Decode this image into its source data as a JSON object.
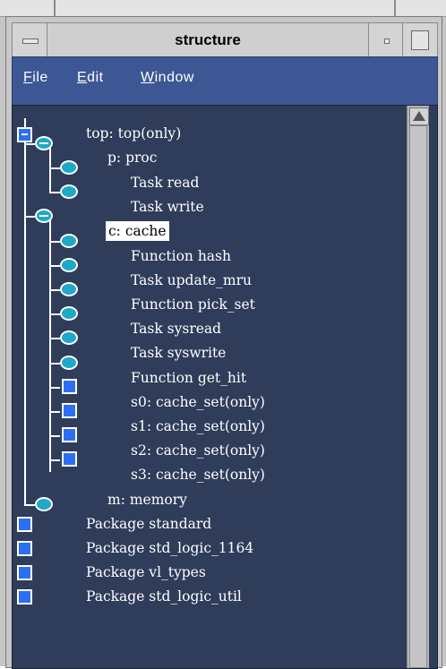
{
  "window": {
    "title": "structure"
  },
  "menu": {
    "file": {
      "first": "F",
      "rest": "ile"
    },
    "edit": {
      "first": "E",
      "rest": "dit"
    },
    "window": {
      "first": "W",
      "rest": "indow"
    }
  },
  "tree": {
    "top": "top: top(only)",
    "proc": "p: proc",
    "task_read": "Task read",
    "task_write": "Task write",
    "cache": "c: cache",
    "function_hash": "Function hash",
    "task_update_mru": "Task update_mru",
    "function_pick_set": "Function pick_set",
    "task_sysread": "Task sysread",
    "task_syswrite": "Task syswrite",
    "function_get_hit": "Function get_hit",
    "s0": "s0: cache_set(only)",
    "s1": "s1: cache_set(only)",
    "s2": "s2: cache_set(only)",
    "s3": "s3: cache_set(only)",
    "memory": "m: memory",
    "pkg_standard": "Package standard",
    "pkg_std_logic_1164": "Package std_logic_1164",
    "pkg_vl_types": "Package vl_types",
    "pkg_std_logic_util": "Package std_logic_util"
  },
  "selected": "c: cache",
  "colors": {
    "menubar": "#3d5795",
    "panel": "#2f3c5a",
    "square_icon": "#2c6ff2",
    "oval_icon": "#1fa8c8"
  }
}
